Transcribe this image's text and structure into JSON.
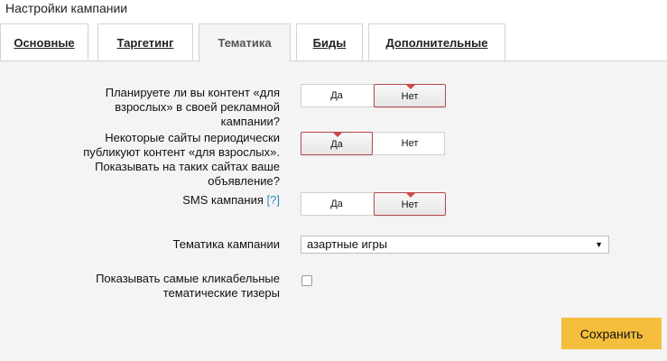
{
  "page": {
    "title": "Настройки кампании"
  },
  "tabs": [
    {
      "label": "Основные",
      "active": false
    },
    {
      "label": "Таргетинг",
      "active": false
    },
    {
      "label": "Тематика",
      "active": true
    },
    {
      "label": "Биды",
      "active": false
    },
    {
      "label": "Дополнительные",
      "active": false
    }
  ],
  "questions": {
    "adult_content": {
      "label": "Планируете ли вы контент «для взрослых» в своей рекламной кампании?",
      "yes": "Да",
      "no": "Нет",
      "selected": "Нет"
    },
    "adult_sites": {
      "label": "Некоторые сайты периодически публикуют контент «для взрослых». Показывать на таких сайтах ваше объявление?",
      "yes": "Да",
      "no": "Нет",
      "selected": "Да"
    },
    "sms_campaign": {
      "label": "SMS кампания",
      "help": "[?]",
      "yes": "Да",
      "no": "Нет",
      "selected": "Нет"
    },
    "topic": {
      "label": "Тематика кампании",
      "value": "азартные игры"
    },
    "clickable_teasers": {
      "label": "Показывать самые кликабельные тематические тизеры",
      "checked": false
    }
  },
  "actions": {
    "save_label": "Сохранить"
  },
  "colors": {
    "accent_button": "#f5be3c",
    "selected_border": "#b64a4a",
    "help_link": "#2a8fbd"
  },
  "icons": {
    "select_arrow": "triangle-down-icon",
    "selected_marker": "triangle-down-icon"
  }
}
